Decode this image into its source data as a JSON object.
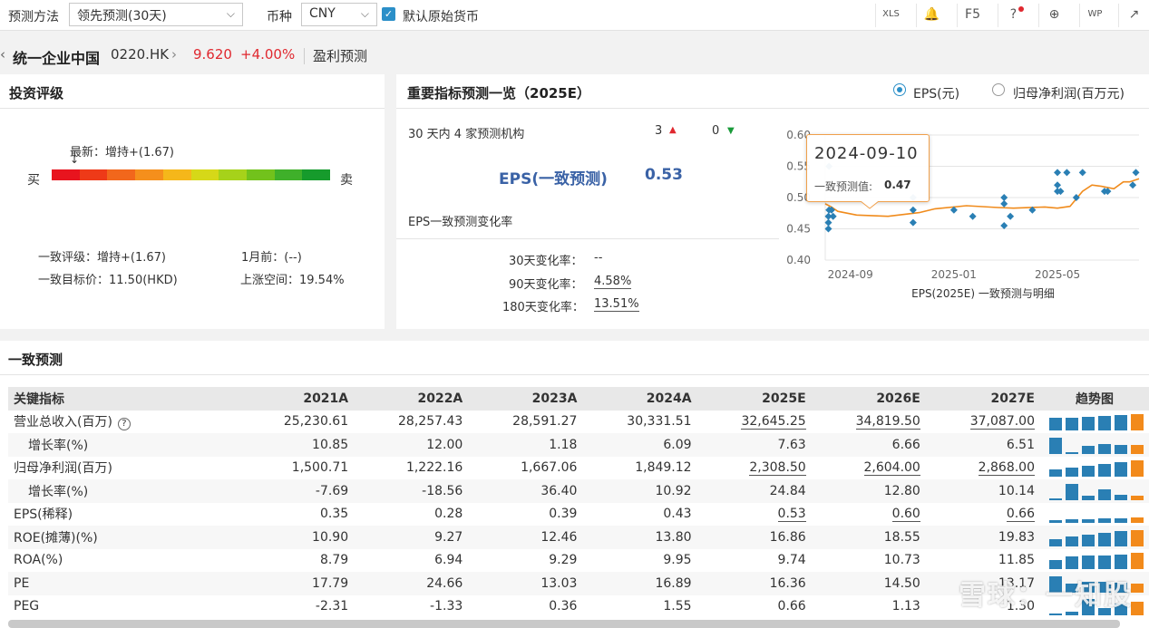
{
  "toolbar": {
    "method_label": "预测方法",
    "method_value": "领先预测(30天)",
    "currency_label": "币种",
    "currency_value": "CNY",
    "default_currency_label": "默认原始货币",
    "tools": [
      "XLS",
      "🔔",
      "F5",
      "?",
      "⊕",
      "WP",
      "↗"
    ]
  },
  "stock": {
    "name": "统一企业中国",
    "code": "0220.HK",
    "price": "9.620",
    "change": "+4.00%",
    "page": "盈利预测"
  },
  "rating": {
    "title": "投资评级",
    "latest": "最新：增持+(1.67)",
    "buy": "买",
    "sell": "卖",
    "colors": [
      "#e8141e",
      "#ee3a18",
      "#f2671c",
      "#f58f1c",
      "#f5b71a",
      "#d6d818",
      "#a6d21a",
      "#72c21c",
      "#3fb02a",
      "#169b2c"
    ],
    "consensus_rating": "一致评级：增持+(1.67)",
    "month_ago": "1月前：(--)",
    "target_price": "一致目标价：11.50(HKD)",
    "upside": "上涨空间：19.54%"
  },
  "forecast": {
    "title": "重要指标预测一览（2025E）",
    "radio_eps": "EPS(元)",
    "radio_profit": "归母净利润(百万元)",
    "institutions": "30 天内 4 家预测机构",
    "up_count": "3",
    "down_count": "0",
    "eps_label": "EPS(一致预测)",
    "eps_value": "0.53",
    "change_title": "EPS一致预测变化率",
    "chg30_label": "30天变化率：",
    "chg30": "--",
    "chg90_label": "90天变化率：",
    "chg90": "4.58%",
    "chg180_label": "180天变化率：",
    "chg180": "13.51%"
  },
  "chart_data": {
    "type": "line",
    "title": "EPS(2025E) 一致预测与明细",
    "y_ticks": [
      "0.60",
      "0.55",
      "0.50",
      "0.45",
      "0.40"
    ],
    "x_ticks": [
      "2024-09",
      "2025-01",
      "2025-05"
    ],
    "ylim": [
      0.4,
      0.6
    ],
    "tooltip_date": "2024-09-10",
    "tooltip_label": "一致预测值:",
    "tooltip_value": "0.47",
    "line": [
      [
        0,
        0.49
      ],
      [
        0.02,
        0.485
      ],
      [
        0.04,
        0.478
      ],
      [
        0.1,
        0.472
      ],
      [
        0.2,
        0.47
      ],
      [
        0.3,
        0.476
      ],
      [
        0.35,
        0.482
      ],
      [
        0.45,
        0.487
      ],
      [
        0.55,
        0.484
      ],
      [
        0.6,
        0.483
      ],
      [
        0.7,
        0.485
      ],
      [
        0.74,
        0.483
      ],
      [
        0.78,
        0.486
      ],
      [
        0.82,
        0.51
      ],
      [
        0.85,
        0.52
      ],
      [
        0.88,
        0.518
      ],
      [
        0.92,
        0.514
      ],
      [
        0.95,
        0.525
      ],
      [
        0.97,
        0.525
      ],
      [
        1.0,
        0.53
      ]
    ],
    "points": [
      [
        0.01,
        0.46
      ],
      [
        0.01,
        0.45
      ],
      [
        0.01,
        0.47
      ],
      [
        0.012,
        0.48
      ],
      [
        0.012,
        0.55
      ],
      [
        0.02,
        0.48
      ],
      [
        0.025,
        0.47
      ],
      [
        0.28,
        0.46
      ],
      [
        0.28,
        0.48
      ],
      [
        0.28,
        0.5
      ],
      [
        0.41,
        0.48
      ],
      [
        0.47,
        0.47
      ],
      [
        0.57,
        0.455
      ],
      [
        0.57,
        0.49
      ],
      [
        0.57,
        0.5
      ],
      [
        0.59,
        0.47
      ],
      [
        0.66,
        0.48
      ],
      [
        0.74,
        0.51
      ],
      [
        0.74,
        0.52
      ],
      [
        0.74,
        0.54
      ],
      [
        0.75,
        0.51
      ],
      [
        0.77,
        0.54
      ],
      [
        0.8,
        0.5
      ],
      [
        0.82,
        0.54
      ],
      [
        0.89,
        0.51
      ],
      [
        0.9,
        0.51
      ],
      [
        0.98,
        0.52
      ],
      [
        0.99,
        0.54
      ]
    ]
  },
  "consensus": {
    "title": "一致预测",
    "headers": [
      "关键指标",
      "2021A",
      "2022A",
      "2023A",
      "2024A",
      "2025E",
      "2026E",
      "2027E",
      "趋势图"
    ],
    "rows": [
      {
        "name": "营业总收入(百万)",
        "info": "?",
        "indent": false,
        "values": [
          "25,230.61",
          "28,257.43",
          "28,591.27",
          "30,331.51",
          "32,645.25",
          "34,819.50",
          "37,087.00"
        ],
        "ul": true,
        "trend": [
          0.7,
          0.75,
          0.78,
          0.82,
          0.88,
          0.94,
          1.0
        ]
      },
      {
        "name": "增长率(%)",
        "indent": true,
        "values": [
          "10.85",
          "12.00",
          "1.18",
          "6.09",
          "7.63",
          "6.66",
          "6.51"
        ],
        "ul": false,
        "trend": [
          0.9,
          1.0,
          0.1,
          0.5,
          0.63,
          0.55,
          0.54
        ]
      },
      {
        "name": "归母净利润(百万)",
        "indent": false,
        "values": [
          "1,500.71",
          "1,222.16",
          "1,667.06",
          "1,849.12",
          "2,308.50",
          "2,604.00",
          "2,868.00"
        ],
        "ul": true,
        "trend": [
          0.52,
          0.42,
          0.58,
          0.64,
          0.8,
          0.9,
          1.0
        ]
      },
      {
        "name": "增长率(%)",
        "indent": true,
        "values": [
          "-7.69",
          "-18.56",
          "36.40",
          "10.92",
          "24.84",
          "12.80",
          "10.14"
        ],
        "ul": false,
        "trend": [
          0.05,
          0.05,
          1.0,
          0.3,
          0.68,
          0.35,
          0.28
        ]
      },
      {
        "name": "EPS(稀释)",
        "indent": false,
        "values": [
          "0.35",
          "0.28",
          "0.39",
          "0.43",
          "0.53",
          "0.60",
          "0.66"
        ],
        "ul": true,
        "trend": [
          0.18,
          0.15,
          0.2,
          0.22,
          0.26,
          0.3,
          0.34
        ]
      },
      {
        "name": "ROE(摊薄)(%)",
        "indent": false,
        "values": [
          "10.90",
          "9.27",
          "12.46",
          "13.80",
          "16.86",
          "18.55",
          "19.83"
        ],
        "ul": false,
        "trend": [
          0.55,
          0.47,
          0.63,
          0.7,
          0.85,
          0.94,
          1.0
        ]
      },
      {
        "name": "ROA(%)",
        "indent": false,
        "values": [
          "8.79",
          "6.94",
          "9.29",
          "9.95",
          "9.74",
          "10.73",
          "11.85"
        ],
        "ul": false,
        "trend": [
          0.74,
          0.58,
          0.78,
          0.84,
          0.82,
          0.9,
          1.0
        ]
      },
      {
        "name": "PE",
        "indent": false,
        "values": [
          "17.79",
          "24.66",
          "13.03",
          "16.89",
          "16.36",
          "14.50",
          "13.17"
        ],
        "ul": false,
        "trend": [
          0.72,
          1.0,
          0.53,
          0.68,
          0.66,
          0.59,
          0.53
        ]
      },
      {
        "name": "PEG",
        "indent": false,
        "values": [
          "-2.31",
          "-1.33",
          "0.36",
          "1.55",
          "0.66",
          "1.13",
          "1.30"
        ],
        "ul": false,
        "trend": [
          0.05,
          0.05,
          0.23,
          1.0,
          0.43,
          0.73,
          0.84
        ]
      }
    ]
  },
  "watermark": "雪球：一知股"
}
